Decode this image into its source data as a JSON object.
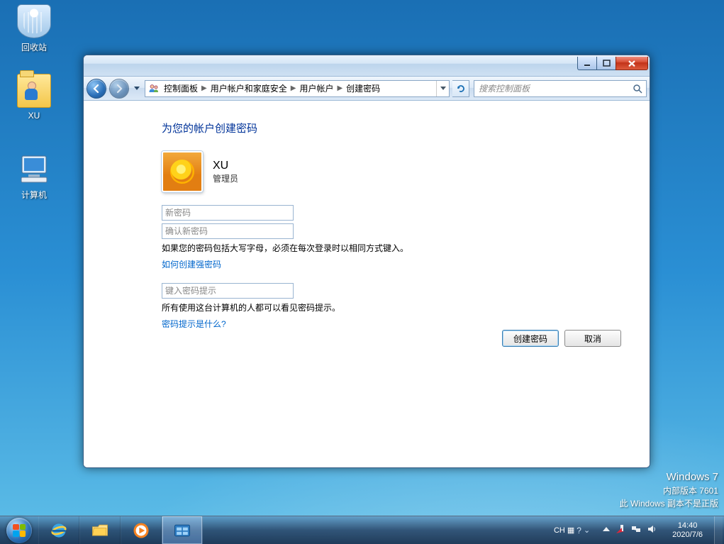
{
  "desktop": {
    "recycle_bin": "回收站",
    "user_folder": "XU",
    "computer": "计算机"
  },
  "watermark": {
    "line1": "Windows 7",
    "line2": "内部版本 7601",
    "line3": "此 Windows 副本不是正版"
  },
  "breadcrumb": {
    "item0": "控制面板",
    "item1": "用户帐户和家庭安全",
    "item2": "用户帐户",
    "item3": "创建密码"
  },
  "search": {
    "placeholder": "搜索控制面板"
  },
  "page": {
    "title": "为您的帐户创建密码",
    "user_name": "XU",
    "user_role": "管理员",
    "new_pw_placeholder": "新密码",
    "confirm_pw_placeholder": "确认新密码",
    "pw_note": "如果您的密码包括大写字母，必须在每次登录时以相同方式键入。",
    "strong_link": "如何创建强密码",
    "hint_placeholder": "键入密码提示",
    "hint_note": "所有使用这台计算机的人都可以看见密码提示。",
    "hint_link": "密码提示是什么?",
    "create_btn": "创建密码",
    "cancel_btn": "取消"
  },
  "tray": {
    "ime_lang": "CH",
    "ime_kbd": "▦",
    "time": "14:40",
    "date": "2020/7/6"
  }
}
